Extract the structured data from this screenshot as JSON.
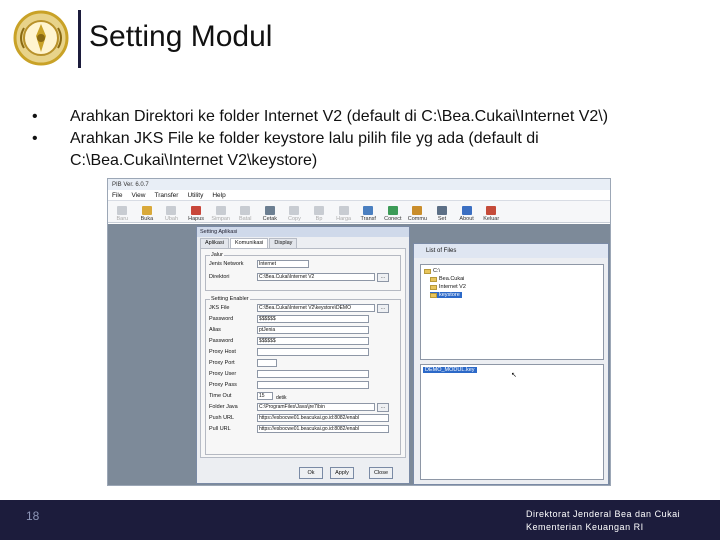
{
  "slide": {
    "title": "Setting Modul",
    "page_number": "18",
    "footer_line1": "Direktorat Jenderal Bea dan Cukai",
    "footer_line2": "Kementerian Keuangan RI",
    "colors": {
      "footer_bg": "#1c1c3c",
      "logo_gold": "#c9a227"
    }
  },
  "bullets": [
    {
      "marker": "•",
      "text": "Arahkan Direktori ke folder Internet V2 (default di C:\\Bea.Cukai\\Internet V2\\)"
    },
    {
      "marker": "•",
      "text": "Arahkan JKS File ke folder keystore lalu pilih file yg ada (default di C:\\Bea.Cukai\\Internet V2\\keystore)"
    }
  ],
  "app": {
    "title": "PIB Ver. 6.0.7",
    "menu": [
      "File",
      "View",
      "Transfer",
      "Utility",
      "Help"
    ],
    "toolbar": [
      {
        "label": "Baru",
        "icon": "new-icon",
        "enabled": false
      },
      {
        "label": "Buka",
        "icon": "open-icon",
        "enabled": true
      },
      {
        "label": "Ubah",
        "icon": "edit-icon",
        "enabled": false
      },
      {
        "label": "Hapus",
        "icon": "delete-icon",
        "enabled": true
      },
      {
        "label": "Simpan",
        "icon": "save-icon",
        "enabled": false
      },
      {
        "label": "Batal",
        "icon": "cancel-icon",
        "enabled": false
      },
      {
        "label": "Cetak",
        "icon": "print-icon",
        "enabled": true
      },
      {
        "label": "Copy",
        "icon": "copy-icon",
        "enabled": false
      },
      {
        "label": "Bp",
        "icon": "bp-icon",
        "enabled": false
      },
      {
        "label": "Harga",
        "icon": "price-icon",
        "enabled": false
      },
      {
        "label": "Transf",
        "icon": "transfer-icon",
        "enabled": true
      },
      {
        "label": "Conect",
        "icon": "connect-icon",
        "enabled": true
      },
      {
        "label": "Commu",
        "icon": "communication-icon",
        "enabled": true
      },
      {
        "label": "Set",
        "icon": "settings-icon",
        "enabled": true
      },
      {
        "label": "About",
        "icon": "about-icon",
        "enabled": true
      },
      {
        "label": "Keluar",
        "icon": "exit-icon",
        "enabled": true
      }
    ]
  },
  "setting_dialog": {
    "title": "Setting Aplikasi",
    "tabs": [
      "Aplikasi",
      "Komunikasi",
      "Display"
    ],
    "active_tab": "Komunikasi",
    "koneksi_group": "Jalur",
    "jenis_network_label": "Jenis Network",
    "jenis_network_value": "Internet",
    "direktori_label": "Direktori",
    "direktori_value": "C:\\Bea.Cukai\\Internet V2",
    "enabler_group": "Setting Enabler",
    "jks_file_label": "JKS File",
    "jks_file_value": "C:\\Bea.Cukai\\Internet V2\\keystore\\DEMO",
    "password_label": "Password",
    "password_value": "$$$$$$",
    "alias_label": "Alias",
    "alias_value": "ptJenia",
    "password2_label": "Password",
    "password2_value": "$$$$$$",
    "proxy_host_label": "Proxy Host",
    "proxy_port_label": "Proxy Port",
    "proxy_user_label": "Proxy User",
    "proxy_pass_label": "Proxy Pass",
    "time_out_label": "Time Out",
    "time_out_value": "15",
    "time_out_unit": "detik",
    "folder_java_label": "Folder Java",
    "folder_java_value": "C:\\ProgramFiles\\Java\\jre7\\bin",
    "push_url_label": "Push URL",
    "push_url_value": "https://esbocwe01.beacukai.go.id:8082/enabl",
    "pull_url_label": "Pull URL",
    "pull_url_value": "https://esbocwe01.beacukai.go.id:8082/enabl",
    "browse_label": "...",
    "ok_label": "Ok",
    "apply_label": "Apply",
    "close_label": "Close"
  },
  "files_dialog": {
    "title": "List of Files",
    "folders": [
      "C:\\",
      "Bea.Cukai",
      "Internet V2",
      "keystore"
    ],
    "selected_folder": "keystore",
    "files": [
      "DEMO_MODUL.key"
    ]
  }
}
